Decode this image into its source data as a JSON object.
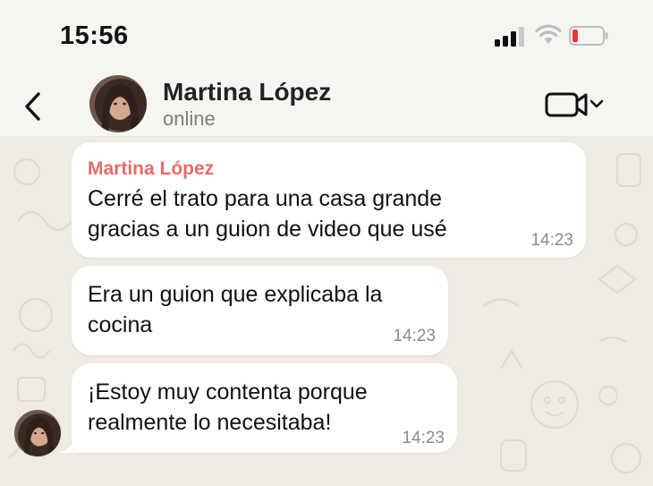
{
  "status_bar": {
    "time": "15:56",
    "signal_icon": "cellular-signal-icon",
    "wifi_icon": "wifi-icon",
    "battery_icon": "battery-low-icon",
    "battery_color": "#e53935"
  },
  "header": {
    "contact_name": "Martina López",
    "contact_status": "online",
    "back_icon": "chevron-left-icon",
    "video_icon": "video-camera-icon",
    "dropdown_icon": "chevron-down-icon"
  },
  "messages": [
    {
      "sender": "Martina López",
      "text": "Cerré el trato para una casa grande\ngracias a un guion de video que usé",
      "time": "14:23"
    },
    {
      "text": "Era un guion que explicaba la\ncocina",
      "time": "14:23"
    },
    {
      "text": "¡Estoy muy contenta porque\nrealmente lo necesitaba!",
      "time": "14:23"
    }
  ],
  "colors": {
    "sender_name": "#ea6a6a",
    "bubble": "#ffffff",
    "chat_background": "#efeae2"
  }
}
